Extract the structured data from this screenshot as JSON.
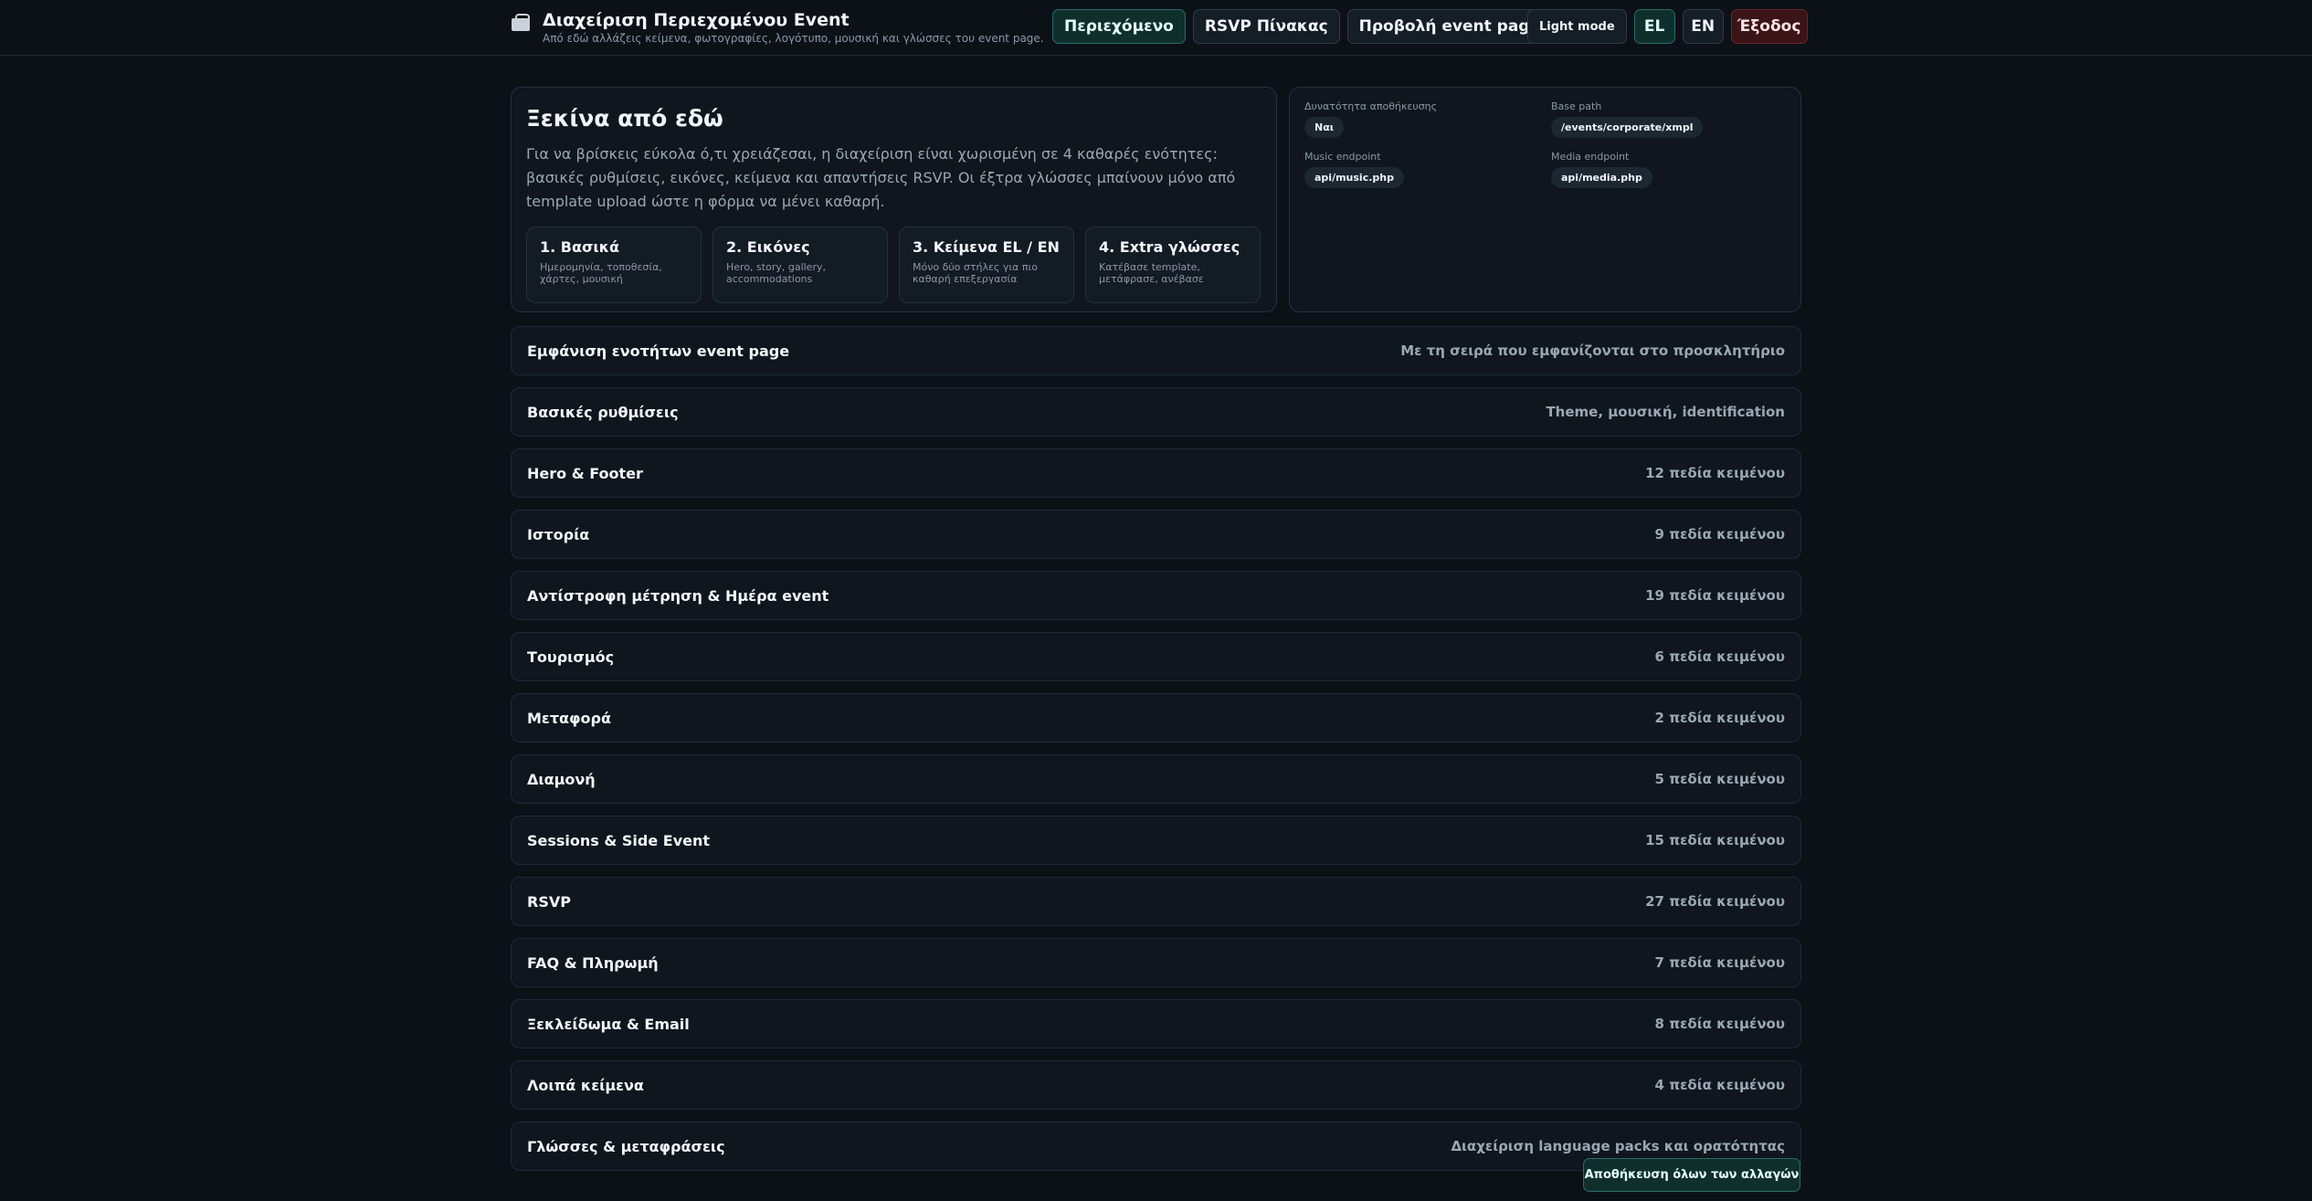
{
  "header": {
    "title": "Διαχείριση Περιεχομένου Event",
    "subtitle": "Από εδώ αλλάζεις κείμενα, φωτογραφίες, λογότυπο, μουσική και γλώσσες του event page.",
    "icon": "briefcase-icon",
    "nav": {
      "content": "Περιεχόμενο",
      "rsvp_table": "RSVP Πίνακας",
      "view_event": "Προβολή event page"
    },
    "light_mode": "Light mode",
    "lang_el": "EL",
    "lang_en": "EN",
    "logout": "Έξοδος"
  },
  "intro": {
    "title": "Ξεκίνα από εδώ",
    "text": "Για να βρίσκεις εύκολα ό,τι χρειάζεσαι, η διαχείριση είναι χωρισμένη σε 4 καθαρές ενότητες: βασικές ρυθμίσεις, εικόνες, κείμενα και απαντήσεις RSVP. Οι έξτρα γλώσσες μπαίνουν μόνο από template upload ώστε η φόρμα να μένει καθαρή.",
    "steps": [
      {
        "title": "1. Βασικά",
        "desc": "Ημερομηνία, τοποθεσία, χάρτες, μουσική"
      },
      {
        "title": "2. Εικόνες",
        "desc": "Hero, story, gallery, accommodations"
      },
      {
        "title": "3. Κείμενα EL / EN",
        "desc": "Μόνο δύο στήλες για πιο καθαρή επεξεργασία"
      },
      {
        "title": "4. Extra γλώσσες",
        "desc": "Κατέβασε template, μετάφρασε, ανέβασε"
      }
    ]
  },
  "meta": {
    "save_capability": {
      "label": "Δυνατότητα αποθήκευσης",
      "value": "Ναι"
    },
    "base_path": {
      "label": "Base path",
      "value": "/events/corporate/xmpl"
    },
    "music_endpoint": {
      "label": "Music endpoint",
      "value": "api/music.php"
    },
    "media_endpoint": {
      "label": "Media endpoint",
      "value": "api/media.php"
    }
  },
  "sections": [
    {
      "title": "Εμφάνιση ενοτήτων event page",
      "meta": "Με τη σειρά που εμφανίζονται στο προσκλητήριο"
    },
    {
      "title": "Βασικές ρυθμίσεις",
      "meta": "Theme, μουσική, identification"
    },
    {
      "title": "Hero & Footer",
      "meta": "12 πεδία κειμένου"
    },
    {
      "title": "Ιστορία",
      "meta": "9 πεδία κειμένου"
    },
    {
      "title": "Αντίστροφη μέτρηση & Ημέρα event",
      "meta": "19 πεδία κειμένου"
    },
    {
      "title": "Τουρισμός",
      "meta": "6 πεδία κειμένου"
    },
    {
      "title": "Μεταφορά",
      "meta": "2 πεδία κειμένου"
    },
    {
      "title": "Διαμονή",
      "meta": "5 πεδία κειμένου"
    },
    {
      "title": "Sessions & Side Event",
      "meta": "15 πεδία κειμένου"
    },
    {
      "title": "RSVP",
      "meta": "27 πεδία κειμένου"
    },
    {
      "title": "FAQ & Πληρωμή",
      "meta": "7 πεδία κειμένου"
    },
    {
      "title": "Ξεκλείδωμα & Email",
      "meta": "8 πεδία κειμένου"
    },
    {
      "title": "Λοιπά κείμενα",
      "meta": "4 πεδία κειμένου"
    },
    {
      "title": "Γλώσσες & μεταφράσεις",
      "meta": "Διαχείριση language packs και ορατότητας"
    }
  ],
  "save_all": "Αποθήκευση όλων των αλλαγών",
  "colors": {
    "background": "#0b1117",
    "accent": "#0f2f2d",
    "danger": "#3a1417"
  }
}
